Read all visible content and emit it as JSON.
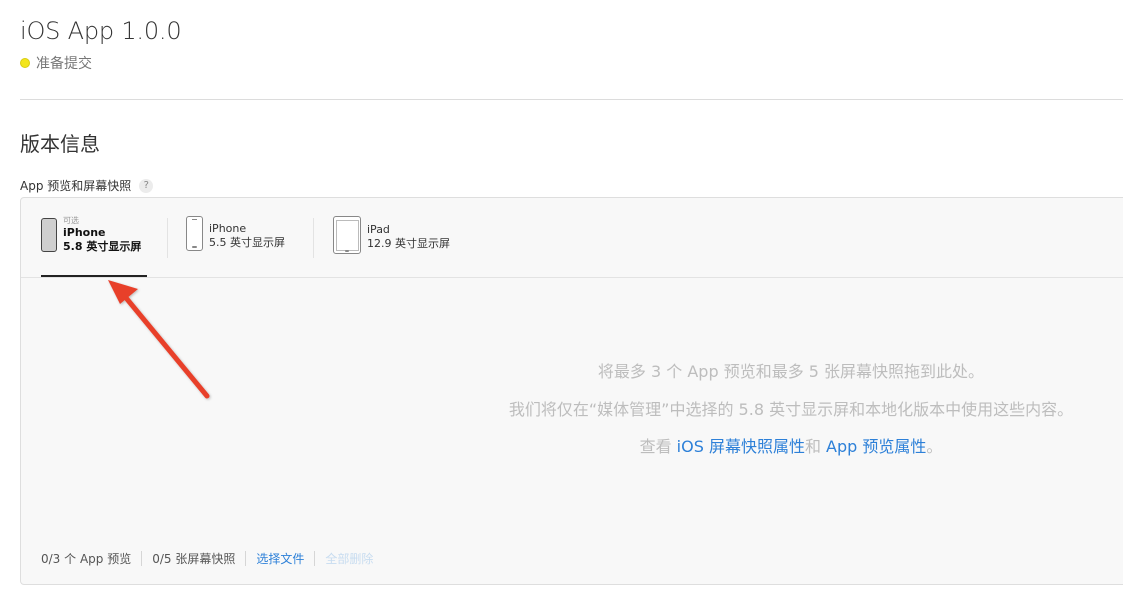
{
  "header": {
    "title": "iOS App 1.0.0",
    "status": "准备提交",
    "status_color": "#f2e51c"
  },
  "section": {
    "title": "版本信息",
    "field_label": "App 预览和屏幕快照",
    "help": "?"
  },
  "device_tabs": [
    {
      "optional": "可选",
      "name": "iPhone",
      "size": "5.8 英寸显示屏",
      "icon": "iphone-x-icon",
      "active": true
    },
    {
      "name": "iPhone",
      "size": "5.5 英寸显示屏",
      "icon": "iphone-icon",
      "active": false
    },
    {
      "name": "iPad",
      "size": "12.9 英寸显示屏",
      "icon": "ipad-icon",
      "active": false
    }
  ],
  "dropzone": {
    "line1": "将最多 3 个 App 预览和最多 5 张屏幕快照拖到此处。",
    "line2": "我们将仅在“媒体管理”中选择的 5.8 英寸显示屏和本地化版本中使用这些内容。",
    "line3_prefix": "查看 ",
    "line3_link1": "iOS 屏幕快照属性",
    "line3_mid": "和 ",
    "line3_link2": "App 预览属性",
    "line3_suffix": "。"
  },
  "footer": {
    "preview_count": "0/3 个 App 预览",
    "screenshot_count": "0/5 张屏幕快照",
    "choose_file": "选择文件",
    "delete_all": "全部删除"
  },
  "colors": {
    "link": "#2d80d8",
    "arrow": "#e8412c"
  }
}
